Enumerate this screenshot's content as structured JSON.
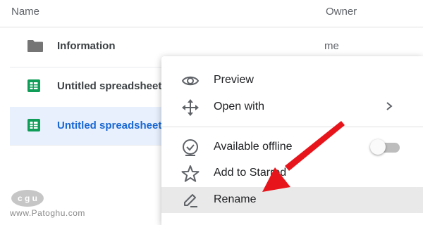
{
  "header": {
    "name": "Name",
    "owner": "Owner"
  },
  "rows": [
    {
      "label": "Information",
      "owner": "me",
      "icon": "folder-icon"
    },
    {
      "label": "Untitled spreadsheet",
      "icon": "sheets-icon"
    },
    {
      "label": "Untitled spreadsheet",
      "icon": "sheets-icon",
      "selected": true
    }
  ],
  "menu": {
    "items": [
      {
        "label": "Preview",
        "icon": "eye-icon"
      },
      {
        "label": "Open with",
        "icon": "move-arrows-icon",
        "submenu": true
      },
      {
        "label": "Available offline",
        "icon": "offline-check-icon",
        "toggle": false
      },
      {
        "label": "Add to Starred",
        "icon": "star-icon"
      },
      {
        "label": "Rename",
        "icon": "pencil-icon",
        "highlighted": true
      }
    ]
  },
  "watermark": {
    "logo": "c g u",
    "text": "www.Patoghu.com"
  },
  "colors": {
    "selected_row_bg": "#e8f0fe",
    "selected_text": "#1967d2",
    "sheets_green": "#0f9d58",
    "arrow_red": "#e8141b",
    "menu_highlight": "#e9e9e9"
  }
}
